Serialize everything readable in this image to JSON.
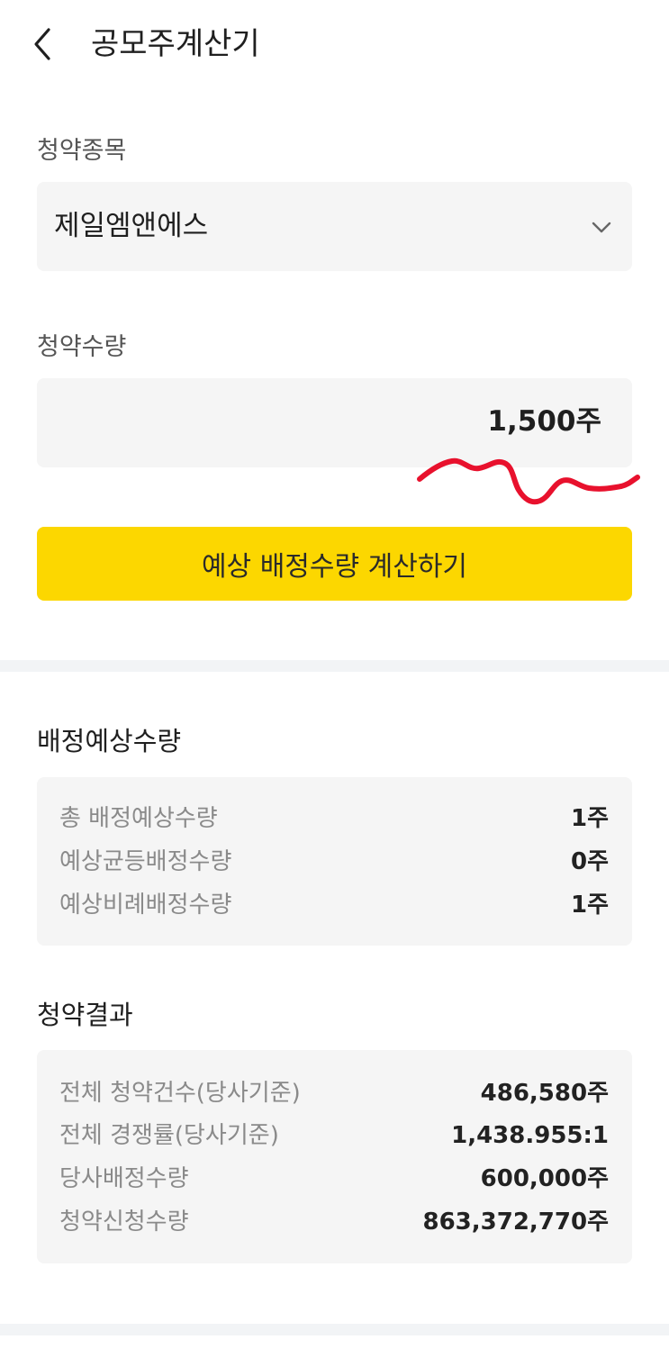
{
  "header": {
    "title": "공모주계산기"
  },
  "subscription_item": {
    "label": "청약종목",
    "value": "제일엠앤에스"
  },
  "subscription_quantity": {
    "label": "청약수량",
    "value": "1,500주"
  },
  "calculate_button": {
    "label": "예상 배정수량 계산하기"
  },
  "allocation": {
    "title": "배정예상수량",
    "rows": [
      {
        "label": "총 배정예상수량",
        "value": "1주"
      },
      {
        "label": "예상균등배정수량",
        "value": "0주"
      },
      {
        "label": "예상비례배정수량",
        "value": "1주"
      }
    ]
  },
  "result": {
    "title": "청약결과",
    "rows": [
      {
        "label": "전체 청약건수(당사기준)",
        "value": "486,580주"
      },
      {
        "label": "전체 경쟁률(당사기준)",
        "value": "1,438.955:1"
      },
      {
        "label": "당사배정수량",
        "value": "600,000주"
      },
      {
        "label": "청약신청수량",
        "value": "863,372,770주"
      }
    ]
  },
  "colors": {
    "accent": "#fcd700",
    "field_bg": "#f5f5f5",
    "scribble": "#e8112d"
  }
}
